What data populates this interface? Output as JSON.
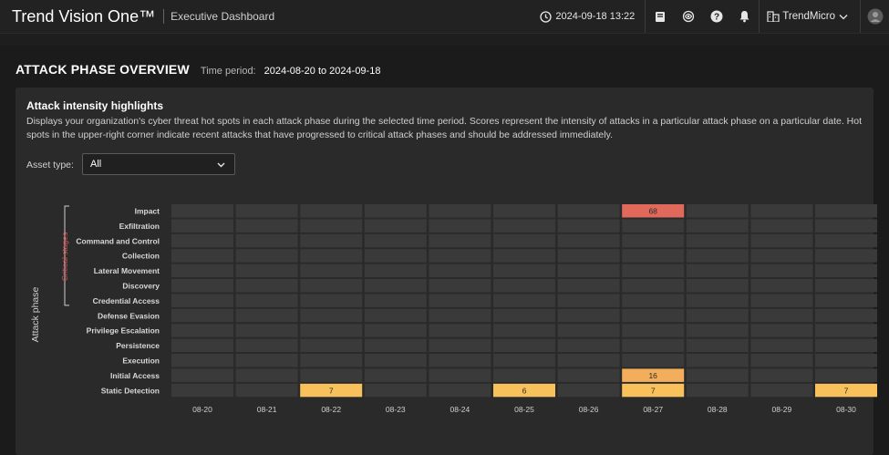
{
  "header": {
    "app_title": "Trend Vision One™",
    "subtitle": "Executive Dashboard",
    "datetime": "2024-09-18 13:22",
    "org": "TrendMicro"
  },
  "icons": [
    "clock-icon",
    "book-icon",
    "ai-assistant-icon",
    "help-icon",
    "bell-icon",
    "building-icon",
    "chevron-down-icon",
    "user-avatar-icon"
  ],
  "page": {
    "title": "ATTACK PHASE OVERVIEW",
    "time_period_label": "Time period:",
    "time_period_value": "2024-08-20 to 2024-09-18"
  },
  "panel": {
    "title": "Attack intensity highlights",
    "description": "Displays your organization's cyber threat hot spots in each attack phase during the selected time period. Scores represent the intensity of attacks in a particular attack phase on a particular date. Hot spots in the upper-right corner indicate recent attacks that have progressed to critical attack phases and should be addressed immediately.",
    "asset_type_label": "Asset type:",
    "asset_type_value": "All"
  },
  "colors": {
    "cell_empty": "#3a3a3a",
    "low": "#f8c15c",
    "medium": "#f2ae5b",
    "high": "#e0695c",
    "critical_label": "#d9534f"
  },
  "chart_data": {
    "type": "heatmap",
    "ylabel": "Attack phase",
    "critical_label": "Critical stages",
    "rows": [
      "Impact",
      "Exfiltration",
      "Command and Control",
      "Collection",
      "Lateral Movement",
      "Discovery",
      "Credential Access",
      "Defense Evasion",
      "Privilege Escalation",
      "Persistence",
      "Execution",
      "Initial Access",
      "Static Detection"
    ],
    "columns": [
      "08-20",
      "08-21",
      "08-22",
      "08-23",
      "08-24",
      "08-25",
      "08-26",
      "08-27",
      "08-28",
      "08-29",
      "08-30"
    ],
    "values": [
      [
        null,
        null,
        null,
        null,
        null,
        null,
        null,
        68,
        null,
        null,
        null
      ],
      [
        null,
        null,
        null,
        null,
        null,
        null,
        null,
        null,
        null,
        null,
        null
      ],
      [
        null,
        null,
        null,
        null,
        null,
        null,
        null,
        null,
        null,
        null,
        null
      ],
      [
        null,
        null,
        null,
        null,
        null,
        null,
        null,
        null,
        null,
        null,
        null
      ],
      [
        null,
        null,
        null,
        null,
        null,
        null,
        null,
        null,
        null,
        null,
        null
      ],
      [
        null,
        null,
        null,
        null,
        null,
        null,
        null,
        null,
        null,
        null,
        null
      ],
      [
        null,
        null,
        null,
        null,
        null,
        null,
        null,
        null,
        null,
        null,
        null
      ],
      [
        null,
        null,
        null,
        null,
        null,
        null,
        null,
        null,
        null,
        null,
        null
      ],
      [
        null,
        null,
        null,
        null,
        null,
        null,
        null,
        null,
        null,
        null,
        null
      ],
      [
        null,
        null,
        null,
        null,
        null,
        null,
        null,
        null,
        null,
        null,
        null
      ],
      [
        null,
        null,
        null,
        null,
        null,
        null,
        null,
        null,
        null,
        null,
        null
      ],
      [
        null,
        null,
        null,
        null,
        null,
        null,
        null,
        16,
        null,
        null,
        null
      ],
      [
        null,
        null,
        7,
        null,
        null,
        6,
        null,
        7,
        null,
        null,
        7
      ]
    ]
  }
}
